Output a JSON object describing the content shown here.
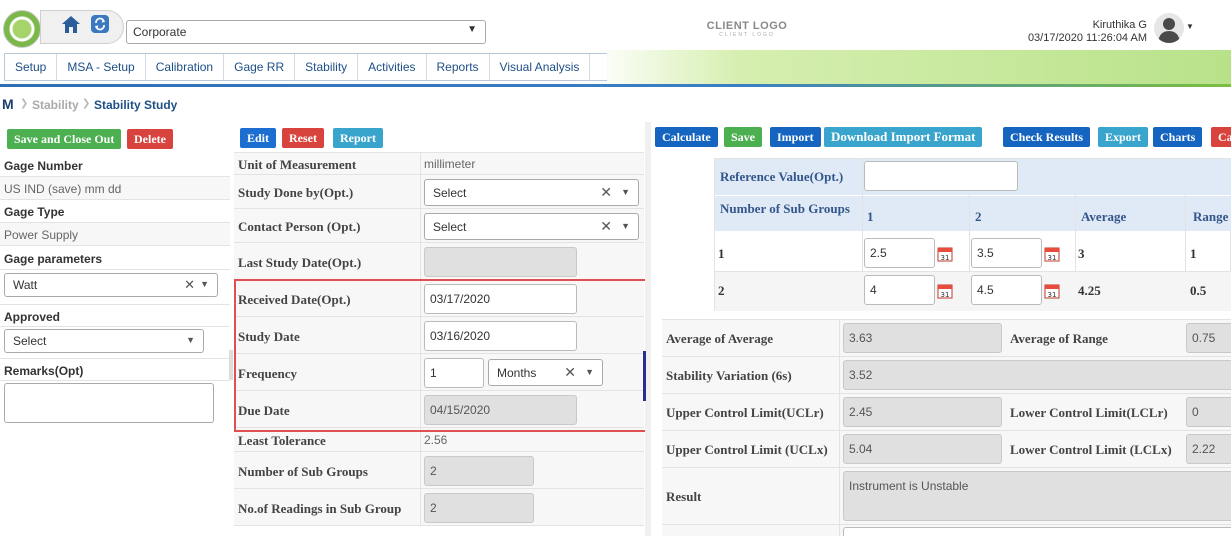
{
  "header": {
    "org_select": "Corporate",
    "client_logo_main": "CLIENT LOGO",
    "client_logo_sub": "CLIENT LOGO",
    "user_name": "Kiruthika G",
    "user_datetime": "03/17/2020 11:26:04 AM"
  },
  "menu": [
    "Setup",
    "MSA - Setup",
    "Calibration",
    "Gage RR",
    "Stability",
    "Activities",
    "Reports",
    "Visual Analysis"
  ],
  "breadcrumb": {
    "parent": "Stability",
    "current": "Stability Study"
  },
  "left": {
    "buttons": {
      "save_close": "Save and Close Out",
      "delete": "Delete"
    },
    "gage_number_label": "Gage Number",
    "gage_number_value": "US IND (save) mm dd",
    "gage_type_label": "Gage Type",
    "gage_type_value": "Power Supply",
    "gage_params_label": "Gage parameters",
    "gage_params_value": "Watt",
    "approved_label": "Approved",
    "approved_value": "Select",
    "remarks_label": "Remarks(Opt)"
  },
  "middle": {
    "buttons": {
      "edit": "Edit",
      "reset": "Reset",
      "report": "Report"
    },
    "uom_label": "Unit of Measurement",
    "uom_value": "millimeter",
    "study_done_label": "Study Done by(Opt.)",
    "study_done_value": "Select",
    "contact_label": "Contact Person (Opt.)",
    "contact_value": "Select",
    "last_study_label": "Last Study Date(Opt.)",
    "last_study_value": "",
    "received_label": "Received Date(Opt.)",
    "received_value": "03/17/2020",
    "study_date_label": "Study Date",
    "study_date_value": "03/16/2020",
    "frequency_label": "Frequency",
    "frequency_value": "1",
    "frequency_unit": "Months",
    "due_label": "Due Date",
    "due_value": "04/15/2020",
    "least_tol_label": "Least Tolerance",
    "least_tol_value": "2.56",
    "num_sub_label": "Number of Sub Groups",
    "num_sub_value": "2",
    "readings_label": "No.of Readings in Sub Group",
    "readings_value": "2"
  },
  "right": {
    "buttons": {
      "calculate": "Calculate",
      "save": "Save",
      "import": "Import",
      "download": "Download Import Format",
      "check": "Check Results",
      "export": "Export",
      "charts": "Charts",
      "cancel": "Ca"
    },
    "ref_label": "Reference Value(Opt.)",
    "table_headers": {
      "subgroups": "Number of Sub Groups",
      "c1": "1",
      "c2": "2",
      "avg": "Average",
      "range": "Range"
    },
    "rows": [
      {
        "num": "1",
        "r1": "2.5",
        "r2": "3.5",
        "avg": "3",
        "range": "1"
      },
      {
        "num": "2",
        "r1": "4",
        "r2": "4.5",
        "avg": "4.25",
        "range": "0.5"
      }
    ],
    "avg_avg_label": "Average of Average",
    "avg_avg_value": "3.63",
    "avg_range_label": "Average of Range",
    "avg_range_value": "0.75",
    "stab_var_label": "Stability Variation (6s)",
    "stab_var_value": "3.52",
    "uclr_label": "Upper Control Limit(UCLr)",
    "uclr_value": "2.45",
    "lclr_label": "Lower Control Limit(LCLr)",
    "lclr_value": "0",
    "uclx_label": "Upper Control Limit (UCLx)",
    "uclx_value": "5.04",
    "lclx_label": "Lower Control Limit (LCLx)",
    "lclx_value": "2.22",
    "result_label": "Result",
    "result_value": "Instrument is Unstable"
  }
}
